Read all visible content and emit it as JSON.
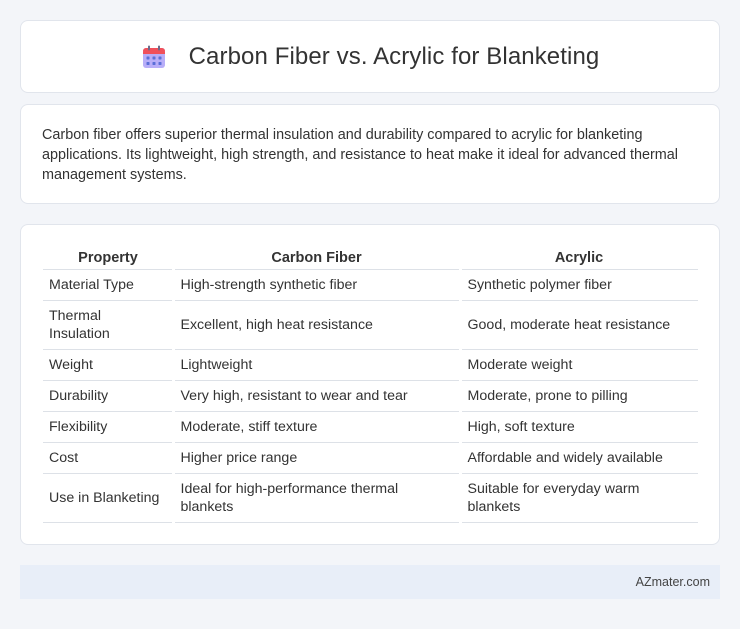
{
  "header": {
    "title": "Carbon Fiber vs. Acrylic for Blanketing",
    "icon": "calendar-icon",
    "icon_colors": {
      "top": "#f0505a",
      "body": "#9b8ff5",
      "dots": "#5b7de8"
    }
  },
  "summary": {
    "text": "Carbon fiber offers superior thermal insulation and durability compared to acrylic for blanketing applications. Its lightweight, high strength, and resistance to heat make it ideal for advanced thermal management systems."
  },
  "table": {
    "headers": [
      "Property",
      "Carbon Fiber",
      "Acrylic"
    ],
    "rows": [
      [
        "Material Type",
        "High-strength synthetic fiber",
        "Synthetic polymer fiber"
      ],
      [
        "Thermal Insulation",
        "Excellent, high heat resistance",
        "Good, moderate heat resistance"
      ],
      [
        "Weight",
        "Lightweight",
        "Moderate weight"
      ],
      [
        "Durability",
        "Very high, resistant to wear and tear",
        "Moderate, prone to pilling"
      ],
      [
        "Flexibility",
        "Moderate, stiff texture",
        "High, soft texture"
      ],
      [
        "Cost",
        "Higher price range",
        "Affordable and widely available"
      ],
      [
        "Use in Blanketing",
        "Ideal for high-performance thermal blankets",
        "Suitable for everyday warm blankets"
      ]
    ]
  },
  "footer": {
    "text": "AZmater.com"
  },
  "colors": {
    "background": "#f3f5f9",
    "card": "#ffffff",
    "border": "#e1e5ec",
    "footer_bg": "#e8eef8"
  }
}
